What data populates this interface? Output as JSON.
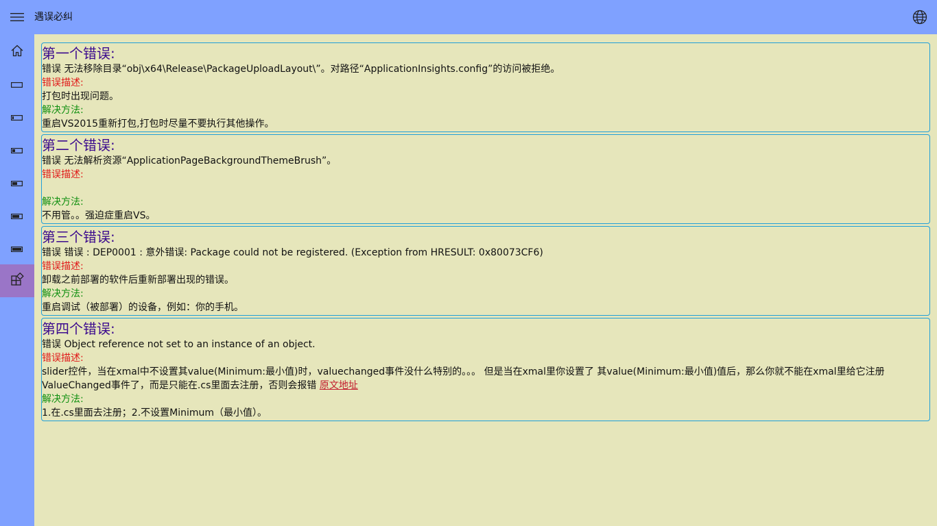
{
  "app": {
    "title": "遇误必纠"
  },
  "icons": {
    "menu": "hamburger-icon",
    "language": "globe-icon",
    "home": "home-icon",
    "battery0": "battery-empty-icon",
    "battery1": "battery-low-icon",
    "battery2": "battery-quarter-icon",
    "battery3": "battery-half-icon",
    "battery4": "battery-threequarter-icon",
    "battery5": "battery-full-icon",
    "apps": "apps-add-icon"
  },
  "colors": {
    "header_bg": "#7fa1ff",
    "content_bg": "#e6e6bb",
    "selected_nav": "#9a75c7",
    "card_border": "#1f9fd8",
    "title_color": "#3b0a8e",
    "desc_label": "#e01818",
    "solution_label": "#0f8f0f"
  },
  "errors": [
    {
      "title": "第一个错误:",
      "message": "错误 无法移除目录“obj\\x64\\Release\\PackageUploadLayout\\”。对路径“ApplicationInsights.config”的访问被拒绝。",
      "desc_label": "错误描述:",
      "description": "打包时出现问题。",
      "solution_label": "解决方法:",
      "solution": "重启VS2015重新打包,打包时尽量不要执行其他操作。"
    },
    {
      "title": "第二个错误:",
      "message": "错误 无法解析资源“ApplicationPageBackgroundThemeBrush”。",
      "desc_label": "错误描述:",
      "description": "",
      "solution_label": "解决方法:",
      "solution": "不用管。。强迫症重启VS。"
    },
    {
      "title": "第三个错误:",
      "message": "错误 错误 : DEP0001 : 意外错误: Package could not be registered. (Exception from HRESULT: 0x80073CF6)",
      "desc_label": "错误描述:",
      "description": "卸载之前部署的软件后重新部署出现的错误。",
      "solution_label": "解决方法:",
      "solution": "重启调试（被部署）的设备，例如：你的手机。"
    },
    {
      "title": "第四个错误:",
      "message": "错误 Object reference not set to an instance of an object.",
      "desc_label": "错误描述:",
      "description": "slider控件，当在xmal中不设置其value(Minimum:最小值)时，valuechanged事件没什么特别的。。。 但是当在xmal里你设置了 其value(Minimum:最小值)值后，那么你就不能在xmal里给它注册ValueChanged事件了，而是只能在.cs里面去注册，否则会报错 ",
      "link": "原文地址",
      "solution_label": "解决方法:",
      "solution": "1.在.cs里面去注册；2.不设置Minimum（最小值）。"
    }
  ]
}
